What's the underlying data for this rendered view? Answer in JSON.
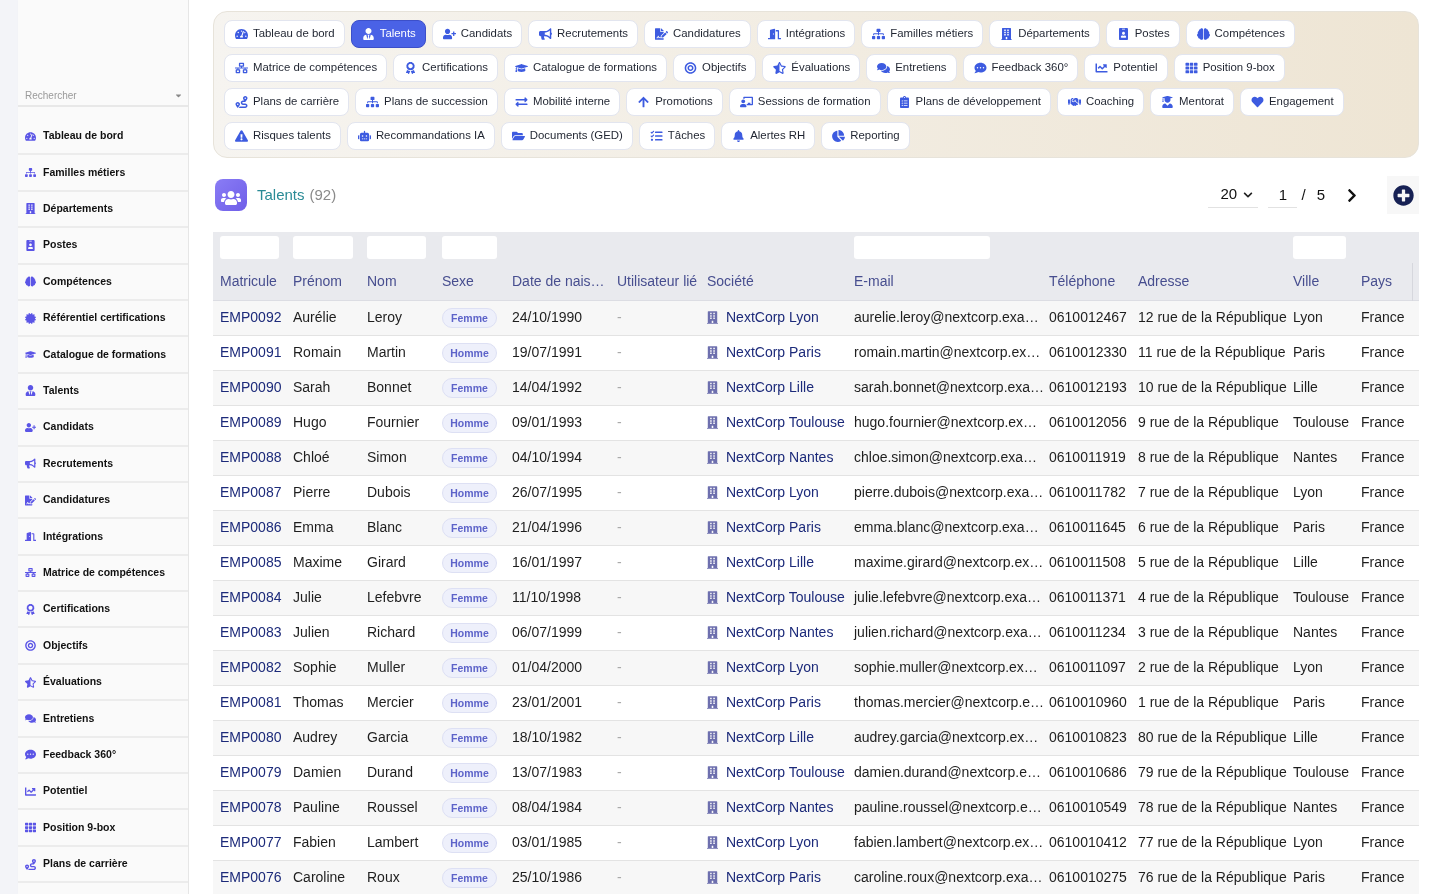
{
  "sidebar": {
    "search": {
      "placeholder": "Rechercher"
    },
    "items": [
      {
        "label": "Tableau de bord"
      },
      {
        "label": "Familles métiers"
      },
      {
        "label": "Départements"
      },
      {
        "label": "Postes"
      },
      {
        "label": "Compétences"
      },
      {
        "label": "Référentiel certifications"
      },
      {
        "label": "Catalogue de formations"
      },
      {
        "label": "Talents"
      },
      {
        "label": "Candidats"
      },
      {
        "label": "Recrutements"
      },
      {
        "label": "Candidatures"
      },
      {
        "label": "Intégrations"
      },
      {
        "label": "Matrice de compétences"
      },
      {
        "label": "Certifications"
      },
      {
        "label": "Objectifs"
      },
      {
        "label": "Évaluations"
      },
      {
        "label": "Entretiens"
      },
      {
        "label": "Feedback 360°"
      },
      {
        "label": "Potentiel"
      },
      {
        "label": "Position 9-box"
      },
      {
        "label": "Plans de carrière"
      }
    ]
  },
  "nav": {
    "tabs": [
      {
        "label": "Tableau de bord",
        "selected": false
      },
      {
        "label": "Talents",
        "selected": true
      },
      {
        "label": "Candidats",
        "selected": false
      },
      {
        "label": "Recrutements",
        "selected": false
      },
      {
        "label": "Candidatures",
        "selected": false
      },
      {
        "label": "Intégrations",
        "selected": false
      },
      {
        "label": "Familles métiers",
        "selected": false
      },
      {
        "label": "Départements",
        "selected": false
      },
      {
        "label": "Postes",
        "selected": false
      },
      {
        "label": "Compétences",
        "selected": false
      },
      {
        "label": "Matrice de compétences",
        "selected": false
      },
      {
        "label": "Certifications",
        "selected": false
      },
      {
        "label": "Catalogue de formations",
        "selected": false
      },
      {
        "label": "Objectifs",
        "selected": false
      },
      {
        "label": "Évaluations",
        "selected": false
      },
      {
        "label": "Entretiens",
        "selected": false
      },
      {
        "label": "Feedback 360°",
        "selected": false
      },
      {
        "label": "Potentiel",
        "selected": false
      },
      {
        "label": "Position 9-box",
        "selected": false
      },
      {
        "label": "Plans de carrière",
        "selected": false
      },
      {
        "label": "Plans de succession",
        "selected": false
      },
      {
        "label": "Mobilité interne",
        "selected": false
      },
      {
        "label": "Promotions",
        "selected": false
      },
      {
        "label": "Sessions de formation",
        "selected": false
      },
      {
        "label": "Plans de développement",
        "selected": false
      },
      {
        "label": "Coaching",
        "selected": false
      },
      {
        "label": "Mentorat",
        "selected": false
      },
      {
        "label": "Engagement",
        "selected": false
      },
      {
        "label": "Risques talents",
        "selected": false
      },
      {
        "label": "Recommandations IA",
        "selected": false
      },
      {
        "label": "Documents (GED)",
        "selected": false
      },
      {
        "label": "Tâches",
        "selected": false
      },
      {
        "label": "Alertes RH",
        "selected": false
      },
      {
        "label": "Reporting",
        "selected": false
      }
    ]
  },
  "header": {
    "title": "Talents",
    "count": "(92)",
    "page_size": "20",
    "page": "1",
    "separator": "/",
    "page_total": "5"
  },
  "table": {
    "columns": [
      {
        "label": "Matricule",
        "filterable": true
      },
      {
        "label": "Prénom",
        "filterable": true
      },
      {
        "label": "Nom",
        "filterable": true
      },
      {
        "label": "Sexe",
        "filterable": true
      },
      {
        "label": "Date de nais…",
        "filterable": false
      },
      {
        "label": "Utilisateur lié",
        "filterable": false
      },
      {
        "label": "Société",
        "filterable": false
      },
      {
        "label": "E-mail",
        "filterable": true
      },
      {
        "label": "Téléphone",
        "filterable": false
      },
      {
        "label": "Adresse",
        "filterable": false
      },
      {
        "label": "Ville",
        "filterable": true
      },
      {
        "label": "Pays",
        "filterable": false
      }
    ],
    "rows": [
      {
        "matricule": "EMP0092",
        "first_name": "Aurélie",
        "last_name": "Leroy",
        "sex": "Femme",
        "birth_date": "24/10/1990",
        "linked_user": "-",
        "company": "NextCorp Lyon",
        "email": "aurelie.leroy@nextcorp.exa…",
        "phone": "0610012467",
        "address": "12 rue de la République",
        "city": "Lyon",
        "country": "France"
      },
      {
        "matricule": "EMP0091",
        "first_name": "Romain",
        "last_name": "Martin",
        "sex": "Homme",
        "birth_date": "19/07/1991",
        "linked_user": "-",
        "company": "NextCorp Paris",
        "email": "romain.martin@nextcorp.ex…",
        "phone": "0610012330",
        "address": "11 rue de la République",
        "city": "Paris",
        "country": "France"
      },
      {
        "matricule": "EMP0090",
        "first_name": "Sarah",
        "last_name": "Bonnet",
        "sex": "Femme",
        "birth_date": "14/04/1992",
        "linked_user": "-",
        "company": "NextCorp Lille",
        "email": "sarah.bonnet@nextcorp.exa…",
        "phone": "0610012193",
        "address": "10 rue de la République",
        "city": "Lille",
        "country": "France"
      },
      {
        "matricule": "EMP0089",
        "first_name": "Hugo",
        "last_name": "Fournier",
        "sex": "Homme",
        "birth_date": "09/01/1993",
        "linked_user": "-",
        "company": "NextCorp Toulouse",
        "email": "hugo.fournier@nextcorp.ex…",
        "phone": "0610012056",
        "address": "9 rue de la République",
        "city": "Toulouse",
        "country": "France"
      },
      {
        "matricule": "EMP0088",
        "first_name": "Chloé",
        "last_name": "Simon",
        "sex": "Femme",
        "birth_date": "04/10/1994",
        "linked_user": "-",
        "company": "NextCorp Nantes",
        "email": "chloe.simon@nextcorp.exa…",
        "phone": "0610011919",
        "address": "8 rue de la République",
        "city": "Nantes",
        "country": "France"
      },
      {
        "matricule": "EMP0087",
        "first_name": "Pierre",
        "last_name": "Dubois",
        "sex": "Homme",
        "birth_date": "26/07/1995",
        "linked_user": "-",
        "company": "NextCorp Lyon",
        "email": "pierre.dubois@nextcorp.exa…",
        "phone": "0610011782",
        "address": "7 rue de la République",
        "city": "Lyon",
        "country": "France"
      },
      {
        "matricule": "EMP0086",
        "first_name": "Emma",
        "last_name": "Blanc",
        "sex": "Femme",
        "birth_date": "21/04/1996",
        "linked_user": "-",
        "company": "NextCorp Paris",
        "email": "emma.blanc@nextcorp.exa…",
        "phone": "0610011645",
        "address": "6 rue de la République",
        "city": "Paris",
        "country": "France"
      },
      {
        "matricule": "EMP0085",
        "first_name": "Maxime",
        "last_name": "Girard",
        "sex": "Homme",
        "birth_date": "16/01/1997",
        "linked_user": "-",
        "company": "NextCorp Lille",
        "email": "maxime.girard@nextcorp.ex…",
        "phone": "0610011508",
        "address": "5 rue de la République",
        "city": "Lille",
        "country": "France"
      },
      {
        "matricule": "EMP0084",
        "first_name": "Julie",
        "last_name": "Lefebvre",
        "sex": "Femme",
        "birth_date": "11/10/1998",
        "linked_user": "-",
        "company": "NextCorp Toulouse",
        "email": "julie.lefebvre@nextcorp.exa…",
        "phone": "0610011371",
        "address": "4 rue de la République",
        "city": "Toulouse",
        "country": "France"
      },
      {
        "matricule": "EMP0083",
        "first_name": "Julien",
        "last_name": "Richard",
        "sex": "Homme",
        "birth_date": "06/07/1999",
        "linked_user": "-",
        "company": "NextCorp Nantes",
        "email": "julien.richard@nextcorp.exa…",
        "phone": "0610011234",
        "address": "3 rue de la République",
        "city": "Nantes",
        "country": "France"
      },
      {
        "matricule": "EMP0082",
        "first_name": "Sophie",
        "last_name": "Muller",
        "sex": "Femme",
        "birth_date": "01/04/2000",
        "linked_user": "-",
        "company": "NextCorp Lyon",
        "email": "sophie.muller@nextcorp.ex…",
        "phone": "0610011097",
        "address": "2 rue de la République",
        "city": "Lyon",
        "country": "France"
      },
      {
        "matricule": "EMP0081",
        "first_name": "Thomas",
        "last_name": "Mercier",
        "sex": "Homme",
        "birth_date": "23/01/2001",
        "linked_user": "-",
        "company": "NextCorp Paris",
        "email": "thomas.mercier@nextcorp.e…",
        "phone": "0610010960",
        "address": "1 rue de la République",
        "city": "Paris",
        "country": "France"
      },
      {
        "matricule": "EMP0080",
        "first_name": "Audrey",
        "last_name": "Garcia",
        "sex": "Femme",
        "birth_date": "18/10/1982",
        "linked_user": "-",
        "company": "NextCorp Lille",
        "email": "audrey.garcia@nextcorp.ex…",
        "phone": "0610010823",
        "address": "80 rue de la République",
        "city": "Lille",
        "country": "France"
      },
      {
        "matricule": "EMP0079",
        "first_name": "Damien",
        "last_name": "Durand",
        "sex": "Homme",
        "birth_date": "13/07/1983",
        "linked_user": "-",
        "company": "NextCorp Toulouse",
        "email": "damien.durand@nextcorp.e…",
        "phone": "0610010686",
        "address": "79 rue de la République",
        "city": "Toulouse",
        "country": "France"
      },
      {
        "matricule": "EMP0078",
        "first_name": "Pauline",
        "last_name": "Roussel",
        "sex": "Femme",
        "birth_date": "08/04/1984",
        "linked_user": "-",
        "company": "NextCorp Nantes",
        "email": "pauline.roussel@nextcorp.e…",
        "phone": "0610010549",
        "address": "78 rue de la République",
        "city": "Nantes",
        "country": "France"
      },
      {
        "matricule": "EMP0077",
        "first_name": "Fabien",
        "last_name": "Lambert",
        "sex": "Homme",
        "birth_date": "03/01/1985",
        "linked_user": "-",
        "company": "NextCorp Lyon",
        "email": "fabien.lambert@nextcorp.ex…",
        "phone": "0610010412",
        "address": "77 rue de la République",
        "city": "Lyon",
        "country": "France"
      },
      {
        "matricule": "EMP0076",
        "first_name": "Caroline",
        "last_name": "Roux",
        "sex": "Femme",
        "birth_date": "25/10/1986",
        "linked_user": "-",
        "company": "NextCorp Paris",
        "email": "caroline.roux@nextcorp.exa…",
        "phone": "0610010275",
        "address": "76 rue de la République",
        "city": "Paris",
        "country": "France"
      }
    ]
  }
}
